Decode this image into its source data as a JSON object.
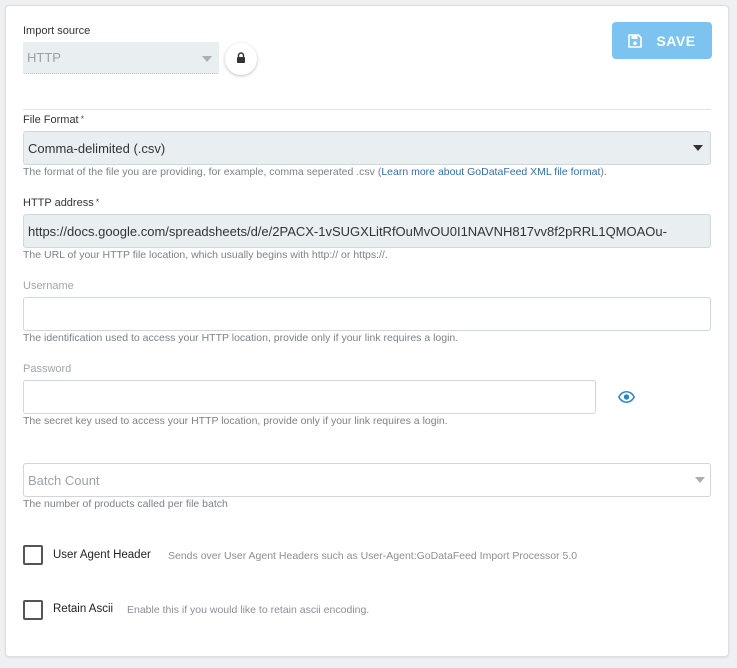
{
  "import_source": {
    "label": "Import source",
    "value": "HTTP"
  },
  "toolbar": {
    "save_label": "SAVE"
  },
  "file_format": {
    "label": "File Format",
    "required_mark": "*",
    "value": "Comma-delimited (.csv)",
    "hint_prefix": "The format of the file you are providing, for example, comma seperated .csv (",
    "hint_link": "Learn more about GoDataFeed XML file format",
    "hint_suffix": ")."
  },
  "http_address": {
    "label": "HTTP address",
    "required_mark": "*",
    "value": "https://docs.google.com/spreadsheets/d/e/2PACX-1vSUGXLitRfOuMvOU0I1NAVNH817vv8f2pRRL1QMOAOu-",
    "hint": "The URL of your HTTP file location, which usually begins with http:// or https://."
  },
  "username": {
    "label": "Username",
    "value": "",
    "hint": "The identification used to access your HTTP location, provide only if your link requires a login."
  },
  "password": {
    "label": "Password",
    "value": "",
    "hint": "The secret key used to access your HTTP location, provide only if your link requires a login."
  },
  "batch_count": {
    "placeholder": "Batch Count",
    "hint": "The number of products called per file batch"
  },
  "user_agent_header": {
    "label": "User Agent Header",
    "description": "Sends over User Agent Headers such as User-Agent:GoDataFeed Import Processor 5.0",
    "checked": false
  },
  "retain_ascii": {
    "label": "Retain Ascii",
    "description": "Enable this if you would like to retain ascii encoding.",
    "checked": false
  },
  "colors": {
    "accent": "#7cc3ef",
    "link": "#2f6fab",
    "eye_icon": "#2a86c8"
  },
  "icons": {
    "lock": "lock-icon",
    "save": "floppy-disk-icon",
    "eye": "eye-icon"
  }
}
